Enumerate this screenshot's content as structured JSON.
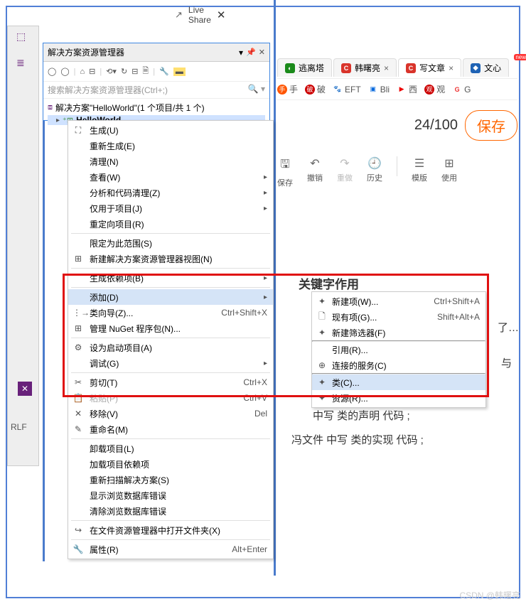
{
  "watermark": "CSDN @韩曙亮",
  "top": {
    "live_share": "Live Share"
  },
  "explorer": {
    "title": "解决方案资源管理器",
    "search_placeholder": "搜索解决方案资源管理器(Ctrl+;)",
    "solution": "解决方案\"HelloWorld\"(1 个项目/共 1 个)",
    "project": "HelloWorld"
  },
  "crlf_label": "RLF",
  "context": {
    "build": "生成(U)",
    "rebuild": "重新生成(E)",
    "clean": "清理(N)",
    "view": "查看(W)",
    "analyze": "分析和代码清理(Z)",
    "project_only": "仅用于项目(J)",
    "retarget": "重定向项目(R)",
    "scope": "限定为此范围(S)",
    "new_view": "新建解决方案资源管理器视图(N)",
    "build_deps": "生成依赖项(B)",
    "add": "添加(D)",
    "class_wizard": "类向导(Z)...",
    "class_wizard_sc": "Ctrl+Shift+X",
    "nuget": "管理 NuGet 程序包(N)...",
    "set_startup": "设为启动项目(A)",
    "debug": "调试(G)",
    "cut": "剪切(T)",
    "cut_sc": "Ctrl+X",
    "paste": "粘贴(P)",
    "paste_sc": "Ctrl+V",
    "remove": "移除(V)",
    "remove_sc": "Del",
    "rename": "重命名(M)",
    "unload": "卸载项目(L)",
    "load_deps": "加载项目依赖项",
    "rescan": "重新扫描解决方案(S)",
    "show_browse_err": "显示浏览数据库错误",
    "clear_browse_err": "清除浏览数据库错误",
    "open_folder": "在文件资源管理器中打开文件夹(X)",
    "properties": "属性(R)",
    "properties_sc": "Alt+Enter"
  },
  "submenu": {
    "new_item": "新建项(W)...",
    "new_item_sc": "Ctrl+Shift+A",
    "existing": "现有项(G)...",
    "existing_sc": "Shift+Alt+A",
    "new_filter": "新建筛选器(F)",
    "reference": "引用(R)...",
    "connected": "连接的服务(C)",
    "class": "类(C)...",
    "resource": "资源(R)..."
  },
  "browser": {
    "tabs": [
      {
        "label": "逃离塔"
      },
      {
        "label": "韩曙亮"
      },
      {
        "label": "写文章"
      },
      {
        "label": "文心"
      }
    ],
    "bookmarks": {
      "hot": "手",
      "po": "破",
      "eft": "EFT",
      "bli": "Bli",
      "xi": "西",
      "guan": "观",
      "g": "G"
    },
    "counter": "24/100",
    "save": "保存",
    "actions": {
      "save": "保存",
      "undo": "撤销",
      "redo": "重做",
      "history": "历史",
      "template": "模版",
      "use": "使用",
      "new_badge": "new"
    }
  },
  "right": {
    "kw_title": "关键字作用",
    "t1": "了…",
    "t2": "与",
    "t3": "中写 类的声明 代码 ;",
    "t4": "冯文件 中写 类的实现 代码 ;"
  }
}
